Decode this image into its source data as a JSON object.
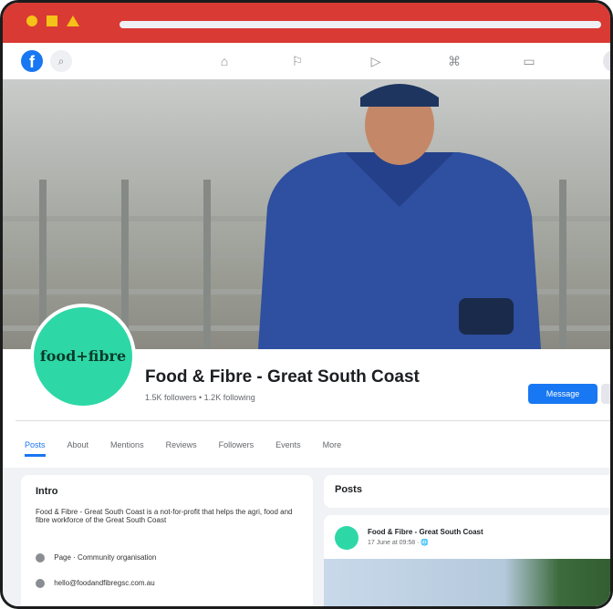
{
  "colors": {
    "window_bar": "#d93a34",
    "facebook_blue": "#1877f2",
    "brand_green": "#2dd8a6"
  },
  "window": {
    "controls": [
      "circle",
      "square",
      "triangle"
    ]
  },
  "fb_nav": {
    "logo_icon": "facebook-logo-icon",
    "icons": [
      "search-icon",
      "home-icon",
      "flag-icon",
      "video-icon",
      "marketplace-icon",
      "groups-icon"
    ]
  },
  "profile": {
    "avatar_logo_text": "food+fibre",
    "name": "Food & Fibre - Great South Coast",
    "stats": "1.5K followers • 1.2K following",
    "message_button": "Message"
  },
  "tabs": [
    {
      "label": "Posts",
      "active": true
    },
    {
      "label": "About"
    },
    {
      "label": "Mentions"
    },
    {
      "label": "Reviews"
    },
    {
      "label": "Followers"
    },
    {
      "label": "Events"
    },
    {
      "label": "More"
    }
  ],
  "intro": {
    "title": "Intro",
    "description": "Food & Fibre - Great South Coast is a not-for-profit that helps the agri, food and fibre workforce of the Great South Coast",
    "items": [
      {
        "icon": "info-icon",
        "text": "Page · Community organisation"
      },
      {
        "icon": "email-icon",
        "text": "hello@foodandfibregsc.com.au"
      }
    ]
  },
  "posts": {
    "title": "Posts",
    "first_post": {
      "author": "Food & Fibre - Great South Coast",
      "time": "17 June at 09:58 · 🌐"
    }
  }
}
